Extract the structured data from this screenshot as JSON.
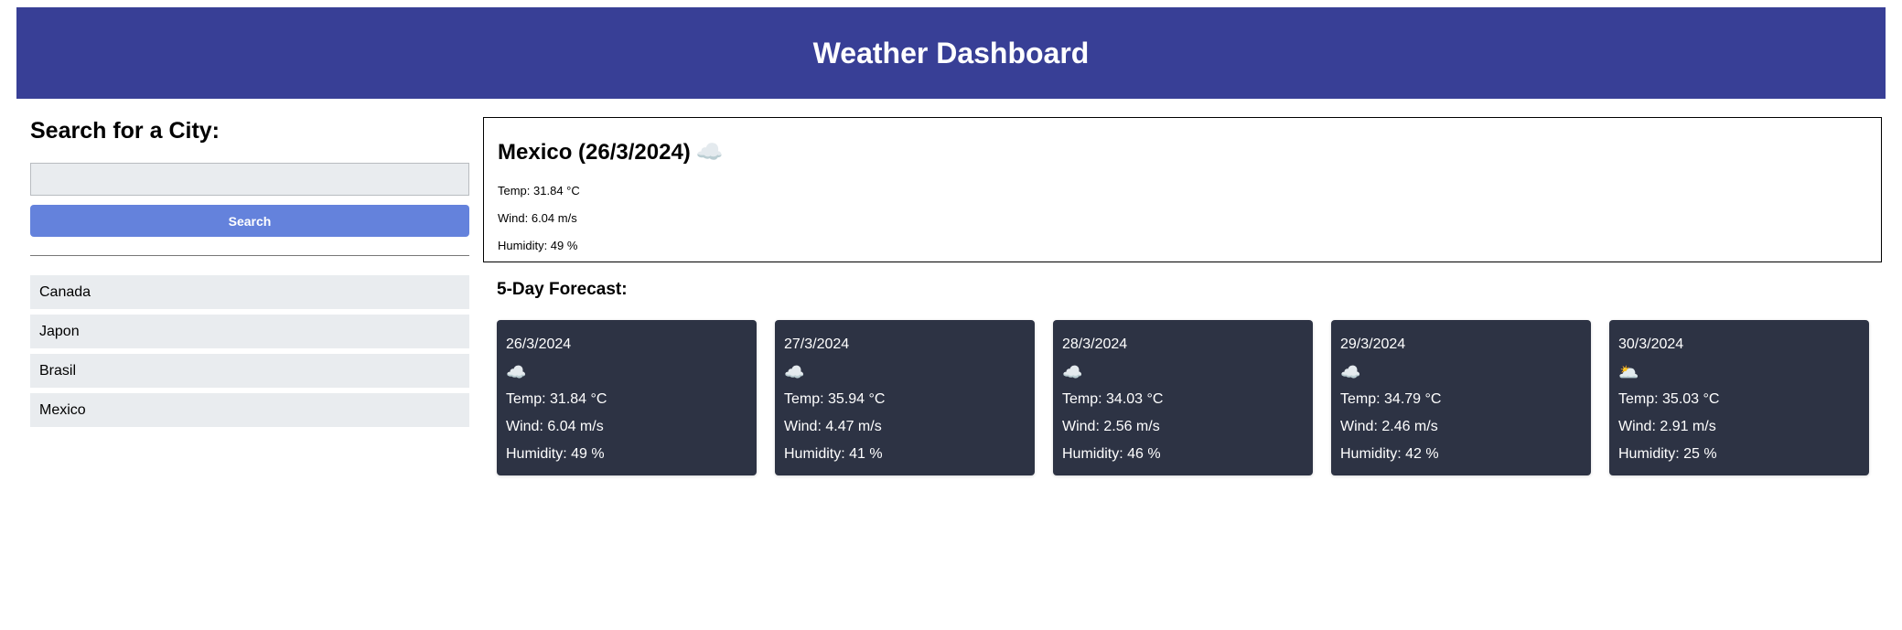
{
  "header": {
    "title": "Weather Dashboard"
  },
  "search": {
    "heading": "Search for a City:",
    "input_value": "",
    "button_label": "Search"
  },
  "history": [
    "Canada",
    "Japon",
    "Brasil",
    "Mexico"
  ],
  "current": {
    "title": "Mexico (26/3/2024)",
    "icon": "☁️",
    "icon_name": "cloud-icon",
    "temp": "Temp: 31.84 °C",
    "wind": "Wind: 6.04 m/s",
    "humidity": "Humidity: 49 %"
  },
  "forecast": {
    "title": "5-Day Forecast:",
    "days": [
      {
        "date": "26/3/2024",
        "icon": "☁️",
        "icon_name": "cloud-icon",
        "temp": "Temp: 31.84 °C",
        "wind": "Wind: 6.04 m/s",
        "humidity": "Humidity: 49 %"
      },
      {
        "date": "27/3/2024",
        "icon": "☁️",
        "icon_name": "cloud-icon",
        "temp": "Temp: 35.94 °C",
        "wind": "Wind: 4.47 m/s",
        "humidity": "Humidity: 41 %"
      },
      {
        "date": "28/3/2024",
        "icon": "☁️",
        "icon_name": "cloud-icon",
        "temp": "Temp: 34.03 °C",
        "wind": "Wind: 2.56 m/s",
        "humidity": "Humidity: 46 %"
      },
      {
        "date": "29/3/2024",
        "icon": "☁️",
        "icon_name": "cloud-icon",
        "temp": "Temp: 34.79 °C",
        "wind": "Wind: 2.46 m/s",
        "humidity": "Humidity: 42 %"
      },
      {
        "date": "30/3/2024",
        "icon": "🌥️",
        "icon_name": "sun-behind-cloud-icon",
        "temp": "Temp: 35.03 °C",
        "wind": "Wind: 2.91 m/s",
        "humidity": "Humidity: 25 %"
      }
    ]
  },
  "colors": {
    "header_bg": "#383f96",
    "button_bg": "#6482dc",
    "card_bg": "#2d3344",
    "history_bg": "#e9ecef"
  }
}
